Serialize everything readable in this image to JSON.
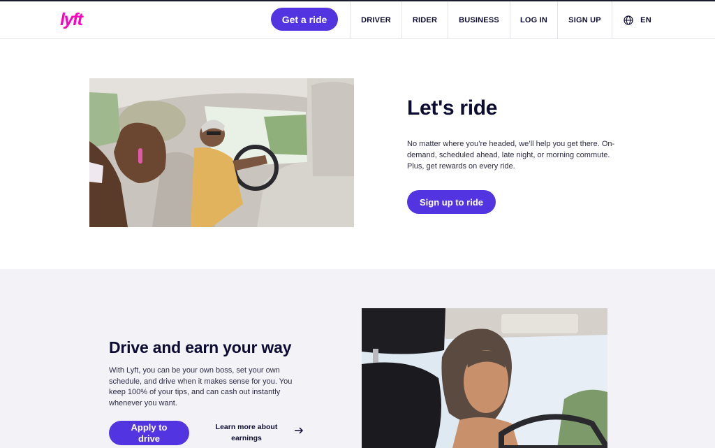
{
  "nav": {
    "logo_text": "lyft",
    "cta_label": "Get a ride",
    "items": [
      {
        "label": "DRIVER"
      },
      {
        "label": "RIDER"
      },
      {
        "label": "BUSINESS"
      },
      {
        "label": "LOG IN"
      },
      {
        "label": "SIGN UP"
      }
    ],
    "language_label": "EN"
  },
  "rider_section": {
    "title": "Let's ride",
    "body": "No matter where you’re headed, we’ll help you get there. On-demand, scheduled ahead, late night, or morning commute. Plus, get rewards on every ride.",
    "button_label": "Sign up to ride"
  },
  "driver_section": {
    "title": "Drive and earn your way",
    "body": "With Lyft, you can be your own boss, set your own schedule, and drive when it makes sense for you. You keep 100% of your tips, and can cash out instantly whenever you want.",
    "apply_label": "Apply to drive",
    "learn_more_label": "Learn more about earnings"
  },
  "colors": {
    "brand_pink": "#ff00bf",
    "accent_purple": "#5235e0",
    "band_background": "#f3f3f7",
    "text_navy": "#0c0b31"
  }
}
